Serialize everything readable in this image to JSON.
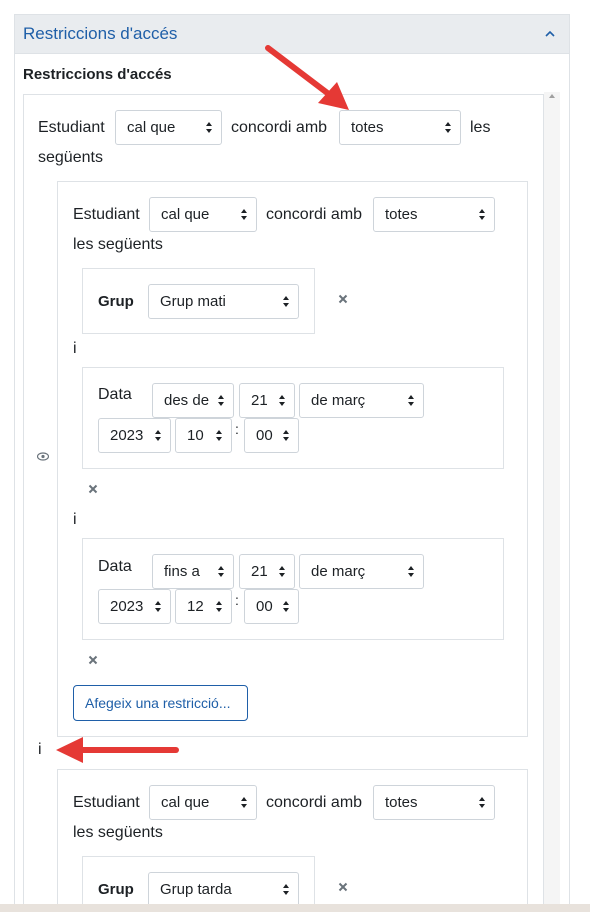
{
  "header": {
    "title": "Restriccions d'accés"
  },
  "section": {
    "label": "Restriccions d'accés"
  },
  "root": {
    "prefix": "Estudiant",
    "must": "cal que",
    "match": "concordi amb",
    "scope": "totes",
    "suffix_part1": "les",
    "suffix_part2": "següents"
  },
  "group1": {
    "prefix": "Estudiant",
    "must": "cal que",
    "match": "concordi amb",
    "scope": "totes",
    "suffix": "les següents",
    "grup": {
      "label": "Grup",
      "value": "Grup mati"
    },
    "and1": "i",
    "date1": {
      "label": "Data",
      "direction": "des de",
      "day": "21",
      "month": "de març",
      "year": "2023",
      "hour": "10",
      "minute": "00"
    },
    "and2": "i",
    "date2": {
      "label": "Data",
      "direction": "fins a",
      "day": "21",
      "month": "de març",
      "year": "2023",
      "hour": "12",
      "minute": "00"
    },
    "add_button": "Afegeix una restricció..."
  },
  "between_and": "i",
  "group2": {
    "prefix": "Estudiant",
    "must": "cal que",
    "match": "concordi amb",
    "scope": "totes",
    "suffix": "les següents",
    "grup": {
      "label": "Grup",
      "value": "Grup tarda"
    }
  },
  "colors": {
    "accent": "#1f5fa8",
    "arrow": "#e53935",
    "header_bg": "#e9ecef"
  },
  "icons": {
    "collapse": "chevron-up-icon",
    "eye": "eye-icon",
    "remove": "close-icon"
  }
}
